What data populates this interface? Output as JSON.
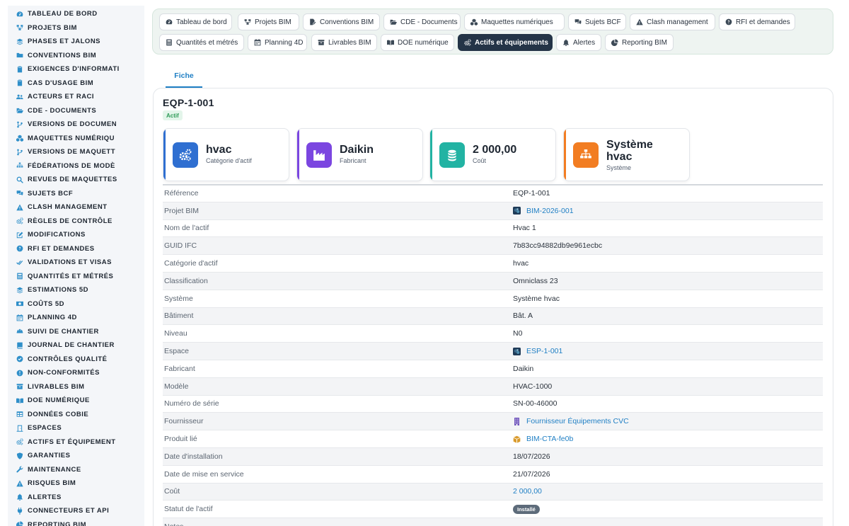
{
  "sidebar": {
    "items": [
      {
        "label": "TABLEAU DE BORD",
        "icon": "dashboard-icon"
      },
      {
        "label": "PROJETS BIM",
        "icon": "project-diagram-icon"
      },
      {
        "label": "PHASES ET JALONS",
        "icon": "layers-icon"
      },
      {
        "label": "CONVENTIONS BIM",
        "icon": "folder-icon"
      },
      {
        "label": "EXIGENCES D'INFORMATI",
        "icon": "clipboard-icon"
      },
      {
        "label": "CAS D'USAGE BIM",
        "icon": "clipboard-icon"
      },
      {
        "label": "ACTEURS ET RACI",
        "icon": "users-icon"
      },
      {
        "label": "CDE - DOCUMENTS",
        "icon": "folder-open-icon"
      },
      {
        "label": "VERSIONS DE DOCUMEN",
        "icon": "code-branch-icon"
      },
      {
        "label": "MAQUETTES NUMÉRIQU",
        "icon": "cubes-icon"
      },
      {
        "label": "VERSIONS DE MAQUETT",
        "icon": "code-branch-icon"
      },
      {
        "label": "FÉDÉRATIONS DE MODÈ",
        "icon": "sitemap-icon"
      },
      {
        "label": "REVUES DE MAQUETTES",
        "icon": "search-icon"
      },
      {
        "label": "SUJETS BCF",
        "icon": "comments-icon"
      },
      {
        "label": "CLASH MANAGEMENT",
        "icon": "warning-icon"
      },
      {
        "label": "RÈGLES DE CONTRÔLE",
        "icon": "cogs-icon"
      },
      {
        "label": "MODIFICATIONS",
        "icon": "edit-icon"
      },
      {
        "label": "RFI ET DEMANDES",
        "icon": "question-circle-icon"
      },
      {
        "label": "VALIDATIONS ET VISAS",
        "icon": "check-double-icon"
      },
      {
        "label": "QUANTITÉS ET MÉTRÉS",
        "icon": "calculator-icon"
      },
      {
        "label": "ESTIMATIONS 5D",
        "icon": "layers-icon"
      },
      {
        "label": "COÛTS 5D",
        "icon": "money-bill-icon"
      },
      {
        "label": "PLANNING 4D",
        "icon": "calendar-icon"
      },
      {
        "label": "SUIVI DE CHANTIER",
        "icon": "hard-hat-icon"
      },
      {
        "label": "JOURNAL DE CHANTIER",
        "icon": "book-icon"
      },
      {
        "label": "CONTRÔLES QUALITÉ",
        "icon": "check-circle-icon"
      },
      {
        "label": "NON-CONFORMITÉS",
        "icon": "exclamation-circle-icon"
      },
      {
        "label": "LIVRABLES BIM",
        "icon": "archive-icon"
      },
      {
        "label": "DOE NUMÉRIQUE",
        "icon": "book-open-icon"
      },
      {
        "label": "DONNÉES COBIE",
        "icon": "table-icon"
      },
      {
        "label": "ESPACES",
        "icon": "door-icon"
      },
      {
        "label": "ACTIFS ET ÉQUIPEMENT",
        "icon": "cogs-icon"
      },
      {
        "label": "GARANTIES",
        "icon": "shield-icon"
      },
      {
        "label": "MAINTENANCE",
        "icon": "wrench-icon"
      },
      {
        "label": "RISQUES BIM",
        "icon": "warning-icon"
      },
      {
        "label": "ALERTES",
        "icon": "bell-icon"
      },
      {
        "label": "CONNECTEURS ET API",
        "icon": "plug-icon"
      },
      {
        "label": "REPORTING BIM",
        "icon": "chart-pie-icon"
      }
    ]
  },
  "nav": {
    "buttons": [
      {
        "label": "Tableau de bord",
        "icon": "dashboard-icon"
      },
      {
        "label": "Projets BIM",
        "icon": "project-diagram-icon"
      },
      {
        "label": "Conventions BIM",
        "icon": "file-signature-icon"
      },
      {
        "label": "CDE - Documents",
        "icon": "folder-open-icon"
      },
      {
        "label": "Maquettes numériques",
        "icon": "cubes-icon"
      },
      {
        "label": "Sujets BCF",
        "icon": "comments-icon"
      },
      {
        "label": "Clash management",
        "icon": "warning-icon"
      },
      {
        "label": "RFI et demandes",
        "icon": "question-circle-icon"
      },
      {
        "label": "Quantités et métrés",
        "icon": "calculator-icon"
      },
      {
        "label": "Planning 4D",
        "icon": "calendar-icon"
      },
      {
        "label": "Livrables BIM",
        "icon": "archive-icon"
      },
      {
        "label": "DOE numérique",
        "icon": "book-open-icon"
      },
      {
        "label": "Actifs et équipements",
        "icon": "cogs-icon",
        "active": true
      },
      {
        "label": "Alertes",
        "icon": "bell-icon"
      },
      {
        "label": "Reporting BIM",
        "icon": "chart-pie-icon"
      }
    ]
  },
  "tabs": {
    "fiche": "Fiche"
  },
  "record": {
    "title": "EQP-1-001",
    "status_badge": "Actif"
  },
  "stats": [
    {
      "value": "hvac",
      "label": "Catégorie d'actif",
      "icon": "cogs-icon",
      "color": "#2f6fd1",
      "bar": "#2f6fd1"
    },
    {
      "value": "Daikin",
      "label": "Fabricant",
      "icon": "industry-icon",
      "color": "#7b46e0",
      "bar": "#7b46e0"
    },
    {
      "value": "2 000,00",
      "label": "Coût",
      "icon": "coins-icon",
      "color": "#22b3a3",
      "bar": "#22b3a3"
    },
    {
      "value": "Système hvac",
      "value_line1": "Système",
      "value_line2": "hvac",
      "label": "Système",
      "icon": "sitemap-icon",
      "color": "#f27d22",
      "bar": "#f27d22"
    }
  ],
  "fields": [
    {
      "key": "Référence",
      "value": "EQP-1-001"
    },
    {
      "key": "Projet BIM",
      "value": "BIM-2026-001",
      "link": true,
      "icon": "model-thumbnail-icon"
    },
    {
      "key": "Nom de l'actif",
      "value": "Hvac 1"
    },
    {
      "key": "GUID IFC",
      "value": "7b83cc94882db9e961ecbc"
    },
    {
      "key": "Catégorie d'actif",
      "value": "hvac"
    },
    {
      "key": "Classification",
      "value": "Omniclass 23"
    },
    {
      "key": "Système",
      "value": "Système hvac"
    },
    {
      "key": "Bâtiment",
      "value": "Bât. A"
    },
    {
      "key": "Niveau",
      "value": "N0"
    },
    {
      "key": "Espace",
      "value": "ESP-1-001",
      "link": true,
      "icon": "model-thumbnail-icon"
    },
    {
      "key": "Fabricant",
      "value": "Daikin"
    },
    {
      "key": "Modèle",
      "value": "HVAC-1000"
    },
    {
      "key": "Numéro de série",
      "value": "SN-00-46000"
    },
    {
      "key": "Fournisseur",
      "value": "Fournisseur Équipements CVC",
      "link": true,
      "icon": "building-icon"
    },
    {
      "key": "Produit lié",
      "value": "BIM-CTA-fe0b",
      "link": true,
      "icon": "box-icon"
    },
    {
      "key": "Date d'installation",
      "value": "18/07/2026"
    },
    {
      "key": "Date de mise en service",
      "value": "21/07/2026"
    },
    {
      "key": "Coût",
      "value": "2 000,00",
      "link": true
    },
    {
      "key": "Statut de l'actif",
      "value": "Installé",
      "pill": true
    },
    {
      "key": "Notes",
      "value": ""
    }
  ],
  "colors": {
    "accent": "#1f7fc4",
    "nav_active": "#243447",
    "sidebar_icon": "#2f8fc9"
  }
}
